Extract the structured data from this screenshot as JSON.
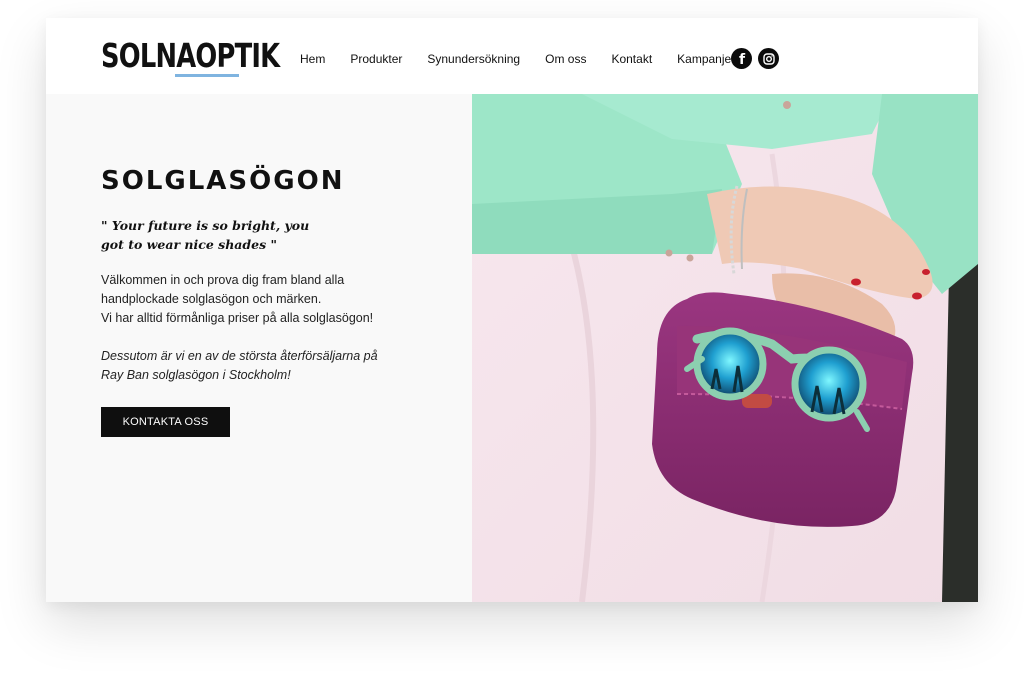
{
  "brand": {
    "logo_text": "SOLNAOPTIK",
    "accent_color": "#7fb4e0"
  },
  "nav": {
    "items": [
      {
        "label": "Hem"
      },
      {
        "label": "Produkter"
      },
      {
        "label": "Synundersökning"
      },
      {
        "label": "Om oss"
      },
      {
        "label": "Kontakt"
      },
      {
        "label": "Kampanjer"
      }
    ]
  },
  "social": {
    "facebook_icon": "facebook-icon",
    "instagram_icon": "instagram-icon",
    "facebook_glyph": "f"
  },
  "hero": {
    "title": "SOLGLASÖGON",
    "quote_line1": "\" Your future is so bright, you",
    "quote_line2": "got to wear nice shades \"",
    "intro_line1": "Välkommen in och prova dig fram bland alla",
    "intro_line2": "handplockade solglasögon och märken.",
    "intro_line3": "Vi har alltid förmånliga priser på alla solglasögon!",
    "note_line1": "Dessutom är vi en av de största återförsäljarna på",
    "note_line2": "Ray Ban  solglasögon i Stockholm!",
    "cta_label": "KONTAKTA OSS"
  },
  "colors": {
    "button_bg": "#0f0f0f",
    "panel_bg": "#f9f9f9",
    "shirt": "#9be3c4",
    "skirt": "#f5e4ea",
    "bag": "#8b2d72"
  }
}
